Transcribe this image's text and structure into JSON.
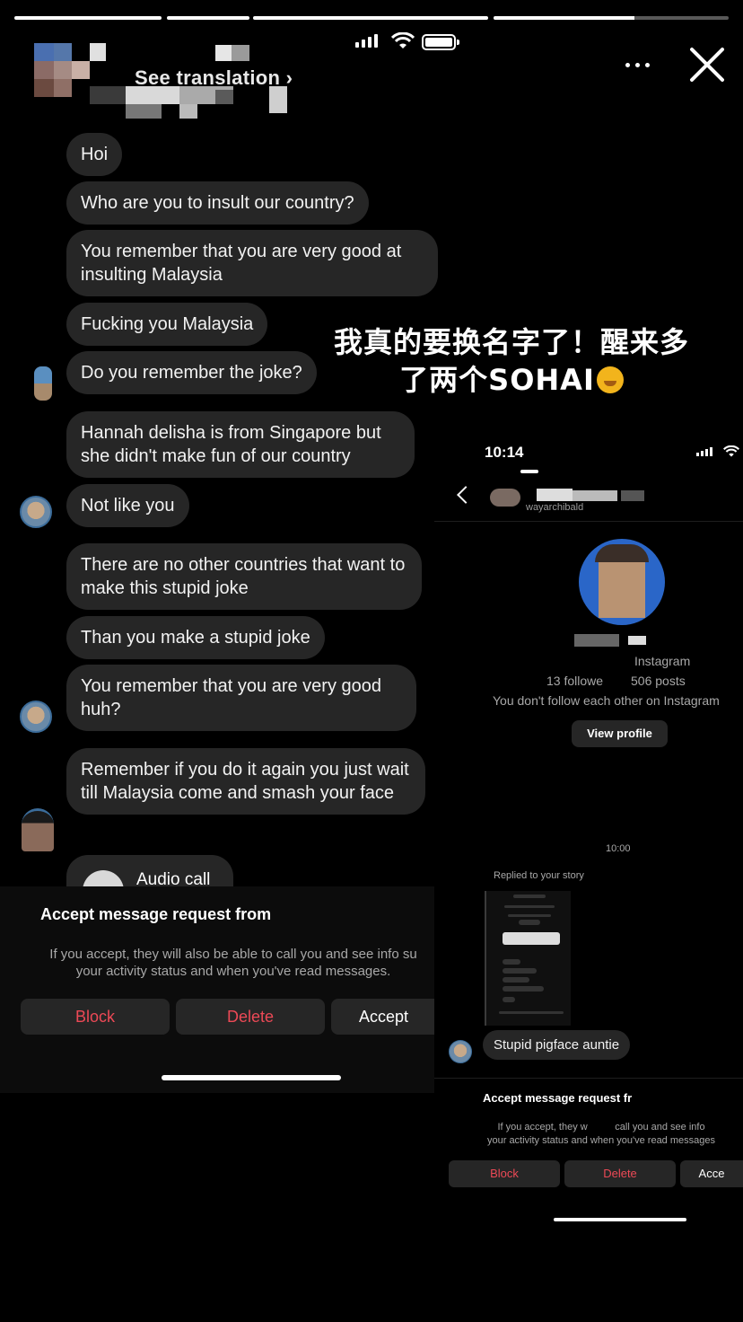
{
  "story": {
    "progress_segments": [
      1,
      1,
      1,
      0.6
    ],
    "see_translation": "See translation"
  },
  "messages": [
    "Hoi",
    "Who are you to insult our country?",
    "You remember that you are very good at insulting Malaysia",
    "Fucking you Malaysia",
    "Do you remember the joke?",
    "Hannah delisha is from Singapore but she didn't make fun of our country",
    "Not like you",
    "There are no other countries that want to make this stupid joke",
    "Than you make a stupid joke",
    "You remember that you are very good huh?",
    "Remember if you do it again you just wait till Malaysia come and smash your face"
  ],
  "audio_call": "Audio call",
  "request_sheet": {
    "title": "Accept message request from",
    "body_line1": "If you accept, they will also be able to call you and see info su",
    "body_line2": "your activity status and when you've read messages.",
    "block": "Block",
    "delete": "Delete",
    "accept": "Accept"
  },
  "overlay_text": {
    "line1": "我真的要换名字了！醒来多",
    "line2": "了两个SOHAI"
  },
  "inset": {
    "time": "10:14",
    "username": "wayarchibald",
    "platform": "Instagram",
    "followers": "13 followe",
    "posts": "506 posts",
    "follow_note": "You don't follow each other on Instagram",
    "view_profile": "View profile",
    "timestamp": "10:00",
    "replied": "Replied to your story",
    "reply_message": "Stupid pigface auntie",
    "sheet_title": "Accept message request fr",
    "sheet_line1": "If you accept, they w          call you and see info",
    "sheet_line2": "your activity status and when you've read messages",
    "block": "Block",
    "delete": "Delete",
    "accept": "Acce"
  },
  "colors": {
    "background": "#000000",
    "bubble": "#262626",
    "danger": "#ed4956",
    "muted_text": "#a8a8a8"
  }
}
